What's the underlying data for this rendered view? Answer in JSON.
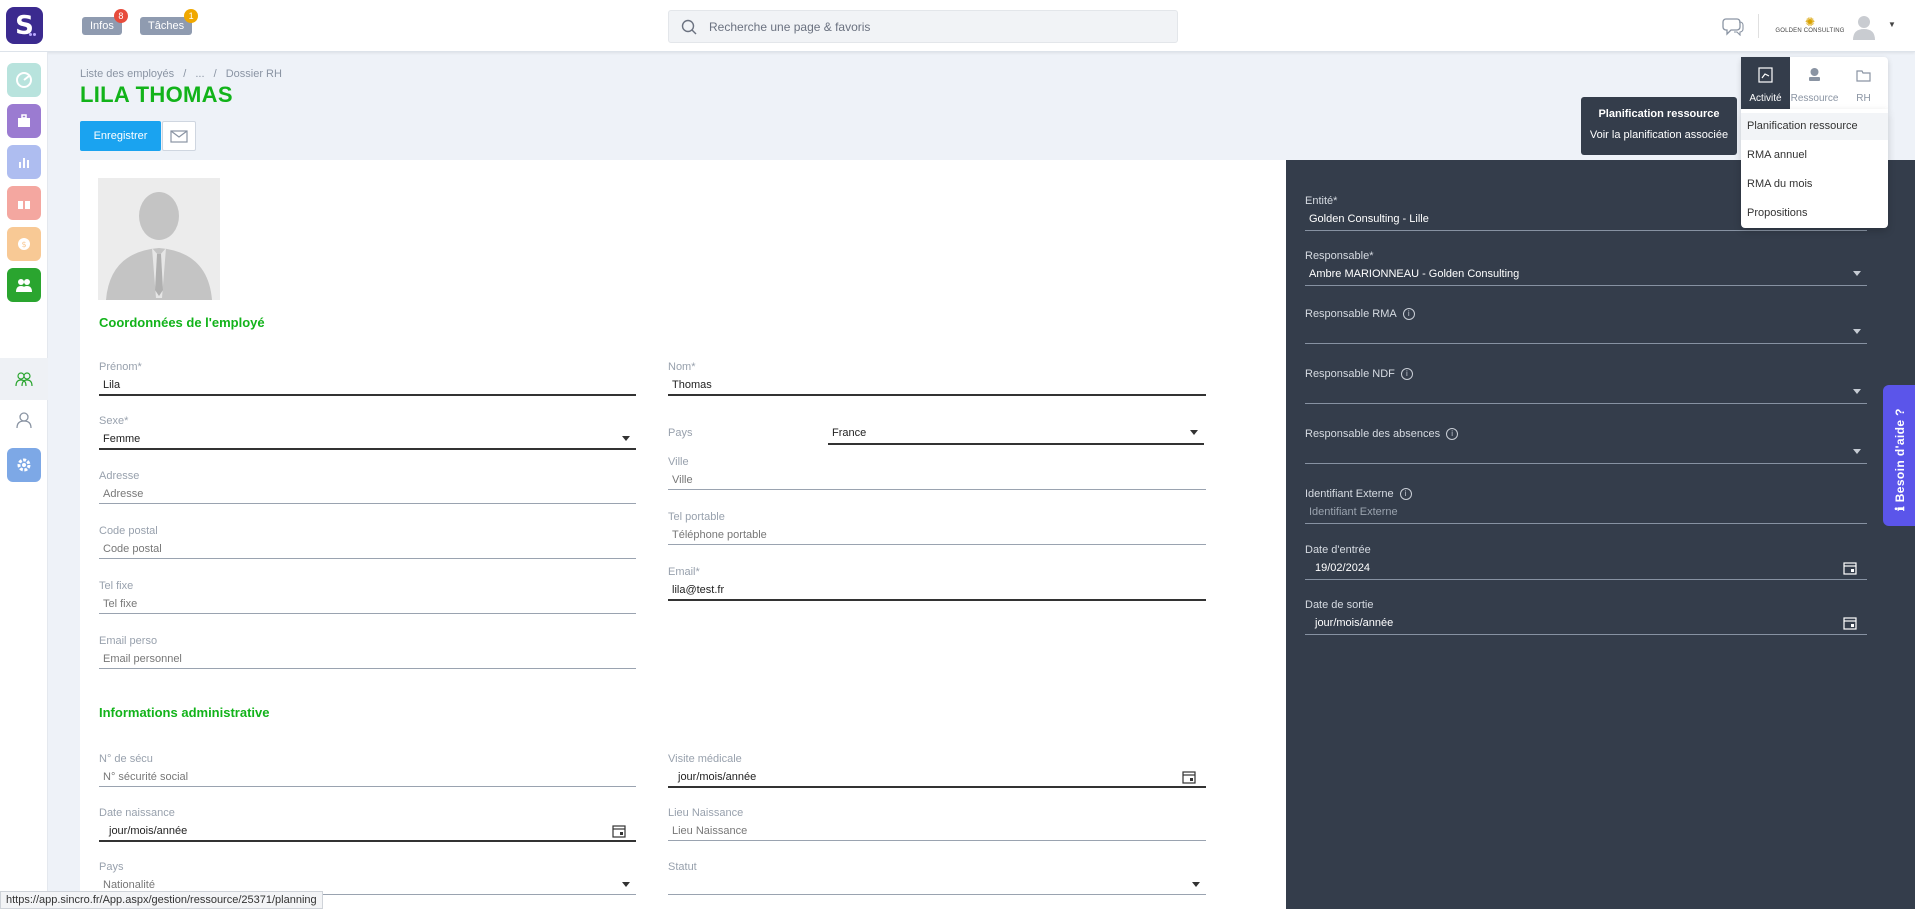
{
  "topbar": {
    "logo_letter": "S",
    "infos": {
      "label": "Infos",
      "badge": "8",
      "badge_color": "#e74c3c"
    },
    "taches": {
      "label": "Tâches",
      "badge": "1",
      "badge_color": "#f0a800"
    },
    "search_placeholder": "Recherche une page & favoris",
    "company_logo_text": "GOLDEN CONSULTING"
  },
  "breadcrumb": {
    "items": [
      "Liste des employés",
      "/",
      "...",
      "/",
      "Dossier RH"
    ]
  },
  "employee": {
    "name": "LILA THOMAS"
  },
  "toolbar": {
    "save_label": "Enregistrer"
  },
  "sections": {
    "coordonnees": "Coordonnées de l'employé",
    "administrative": "Informations administrative"
  },
  "form": {
    "prenom": {
      "label": "Prénom*",
      "value": "Lila"
    },
    "nom": {
      "label": "Nom*",
      "value": "Thomas"
    },
    "sexe": {
      "label": "Sexe*",
      "value": "Femme"
    },
    "pays": {
      "label": "Pays",
      "value": "France"
    },
    "adresse": {
      "label": "Adresse",
      "placeholder": "Adresse"
    },
    "ville": {
      "label": "Ville",
      "placeholder": "Ville"
    },
    "code_postal": {
      "label": "Code postal",
      "placeholder": "Code postal"
    },
    "tel_portable": {
      "label": "Tel portable",
      "placeholder": "Téléphone portable"
    },
    "tel_fixe": {
      "label": "Tel fixe",
      "placeholder": "Tel fixe"
    },
    "email": {
      "label": "Email*",
      "value": "lila@test.fr"
    },
    "email_perso": {
      "label": "Email perso",
      "placeholder": "Email personnel"
    },
    "secu": {
      "label": "N° de sécu",
      "placeholder": "N° sécurité social"
    },
    "visite_medicale": {
      "label": "Visite médicale",
      "placeholder": "jour/mois/année"
    },
    "date_naissance": {
      "label": "Date naissance",
      "placeholder": "jour/mois/année"
    },
    "lieu_naissance": {
      "label": "Lieu Naissance",
      "placeholder": "Lieu Naissance"
    },
    "pays_nat": {
      "label": "Pays",
      "placeholder": "Nationalité"
    },
    "statut": {
      "label": "Statut",
      "value": ""
    }
  },
  "panel": {
    "entite": {
      "label": "Entité*",
      "value": "Golden Consulting - Lille"
    },
    "responsable": {
      "label": "Responsable*",
      "value": "Ambre MARIONNEAU - Golden Consulting"
    },
    "responsable_rma": {
      "label": "Responsable RMA",
      "value": ""
    },
    "responsable_ndf": {
      "label": "Responsable NDF",
      "value": ""
    },
    "responsable_absences": {
      "label": "Responsable des absences",
      "value": ""
    },
    "identifiant_externe": {
      "label": "Identifiant Externe",
      "placeholder": "Identifiant Externe"
    },
    "date_entree": {
      "label": "Date d'entrée",
      "value": "19/02/2024"
    },
    "date_sortie": {
      "label": "Date de sortie",
      "placeholder": "jour/mois/année"
    }
  },
  "actions": {
    "items": [
      {
        "label": "Activité",
        "icon": "document-chart-icon"
      },
      {
        "label": "Ressource",
        "icon": "user-stamp-icon"
      },
      {
        "label": "RH",
        "icon": "folder-icon"
      }
    ],
    "menu": [
      "Planification ressource",
      "RMA annuel",
      "RMA du mois",
      "Propositions"
    ]
  },
  "tooltip": {
    "title": "Planification ressource",
    "subtitle": "Voir la planification associée"
  },
  "help": {
    "label": "Besoin d'aide ?"
  },
  "status_url": "https://app.sincro.fr/App.aspx/gestion/ressource/25371/planning",
  "colors": {
    "accent_green": "#12b31a",
    "primary_blue": "#1aa3f0",
    "dark_panel": "#343d4b",
    "help_purple": "#5b55ea"
  }
}
